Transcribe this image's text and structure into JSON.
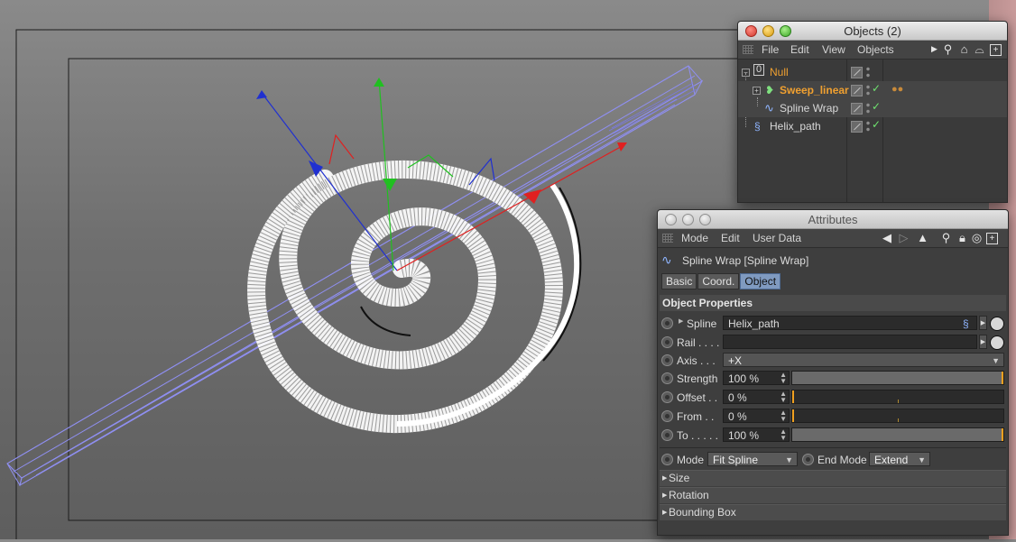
{
  "viewport": {
    "objects": [
      "Spiral sweep mesh",
      "Helix path bounding cage"
    ]
  },
  "objects_window": {
    "title": "Objects (2)",
    "menu": [
      "File",
      "Edit",
      "View",
      "Objects"
    ],
    "rows": [
      {
        "name": "Null",
        "color": "#f0a030"
      },
      {
        "name": "Sweep_linear",
        "color": "#f0a030"
      },
      {
        "name": "Spline Wrap",
        "color": "#d8d8d8"
      },
      {
        "name": "Helix_path",
        "color": "#d8d8d8"
      }
    ]
  },
  "attributes_window": {
    "title": "Attributes",
    "menu": [
      "Mode",
      "Edit",
      "User Data"
    ],
    "object_header": "Spline Wrap [Spline Wrap]",
    "tabs": [
      "Basic",
      "Coord.",
      "Object"
    ],
    "active_tab": "Object",
    "section": "Object Properties",
    "props": {
      "spline": {
        "label": "Spline",
        "value": "Helix_path"
      },
      "rail": {
        "label": "Rail . . . .",
        "value": ""
      },
      "axis": {
        "label": "Axis . . .",
        "value": "+X"
      },
      "strength": {
        "label": "Strength",
        "value": "100 %",
        "fraction": 1.0
      },
      "offset": {
        "label": "Offset . .",
        "value": "0 %",
        "fraction": 0.0
      },
      "from": {
        "label": "From  . .",
        "value": "0 %",
        "fraction": 0.0
      },
      "to": {
        "label": "To . . . . .",
        "value": "100 %",
        "fraction": 1.0
      }
    },
    "mode": {
      "label": "Mode",
      "value": "Fit Spline"
    },
    "end_mode": {
      "label": "End Mode",
      "value": "Extend"
    },
    "groups": [
      "Size",
      "Rotation",
      "Bounding Box"
    ]
  },
  "colors": {
    "x_axis": "#e02020",
    "y_axis": "#20c020",
    "z_axis": "#2030d0",
    "cage": "#8f8ff0",
    "accent_orange": "#f0a030",
    "active_tab": "#7f9ac0"
  }
}
